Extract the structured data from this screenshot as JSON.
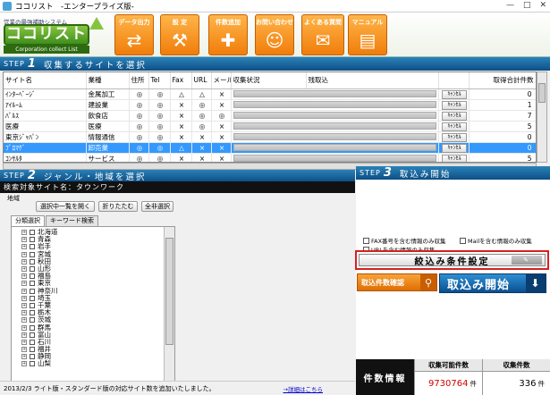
{
  "window": {
    "title": "ココリスト　-エンタープライズ版-",
    "controls": [
      "—",
      "□",
      "✕"
    ]
  },
  "logo": {
    "subtitle": "営業の最強補助システム",
    "main": "ココリスト",
    "english": "Corporation collect List"
  },
  "toolbar": [
    {
      "label": "データ出力",
      "icon": "⇄",
      "icon_name": "export-arrows-icon"
    },
    {
      "label": "設 定",
      "icon": "⚒",
      "icon_name": "wrench-icon"
    },
    {
      "label": "件数追加",
      "icon": "✚",
      "icon_name": "add-document-icon"
    },
    {
      "label": "お問い合わせ",
      "icon": "☺",
      "icon_name": "contact-people-icon"
    },
    {
      "label": "よくある質問",
      "icon": "✉",
      "icon_name": "faq-chat-icon"
    },
    {
      "label": "マニュアル",
      "icon": "▤",
      "icon_name": "manual-book-icon"
    }
  ],
  "step1": {
    "badge": "STEP",
    "num": "1",
    "title": "収集するサイトを選択"
  },
  "site_table": {
    "columns": [
      "サイト名",
      "業種",
      "住所",
      "Tel",
      "Fax",
      "URL",
      "メール",
      "収集状況",
      "残取込",
      "",
      "取得合計件数"
    ],
    "rows": [
      {
        "name": "ｲﾝﾀｰﾍﾞｰｼﾞ",
        "industry": "金属加工",
        "addr": "◎",
        "tel": "◎",
        "fax": "△",
        "url": "△",
        "mail": "×",
        "cancel": "ｷｬﾝｾﾙ",
        "total": "0"
      },
      {
        "name": "ｱｲﾙｰﾑ",
        "industry": "建設業",
        "addr": "◎",
        "tel": "◎",
        "fax": "×",
        "url": "◎",
        "mail": "×",
        "cancel": "ｷｬﾝｾﾙ",
        "total": "1"
      },
      {
        "name": "ﾊﾟﾙｽ",
        "industry": "飲食店",
        "addr": "◎",
        "tel": "◎",
        "fax": "×",
        "url": "◎",
        "mail": "◎",
        "cancel": "ｷｬﾝｾﾙ",
        "total": "7"
      },
      {
        "name": "医療",
        "industry": "医療",
        "addr": "◎",
        "tel": "◎",
        "fax": "×",
        "url": "◎",
        "mail": "×",
        "cancel": "ｷｬﾝｾﾙ",
        "total": "5"
      },
      {
        "name": "東京ｼﾞｬﾊﾟﾝ",
        "industry": "情報通信",
        "addr": "◎",
        "tel": "◎",
        "fax": "×",
        "url": "×",
        "mail": "×",
        "cancel": "ｷｬﾝｾﾙ",
        "total": "0"
      },
      {
        "name": "ﾌﾟﾛﾏｹﾞ",
        "industry": "卸売業",
        "addr": "◎",
        "tel": "◎",
        "fax": "△",
        "url": "×",
        "mail": "×",
        "cancel": "ｷｬﾝｾﾙ",
        "total": "0",
        "selected": true
      },
      {
        "name": "ｺﾝｻﾙﾀ",
        "industry": "サービス",
        "addr": "◎",
        "tel": "◎",
        "fax": "×",
        "url": "×",
        "mail": "×",
        "cancel": "ｷｬﾝｾﾙ",
        "total": "5"
      }
    ]
  },
  "step2": {
    "badge": "STEP",
    "num": "2",
    "title": "ジャンル・地域を選択"
  },
  "category_bar": "検索対象サイト名：タウンワーク",
  "region": {
    "label": "地域",
    "buttons": [
      "選択中一覧を開く",
      "折りたたむ",
      "全非選択"
    ]
  },
  "tabs": [
    "分類選択",
    "キーワード検索"
  ],
  "prefectures": [
    "北海道",
    "青森",
    "岩手",
    "宮城",
    "秋田",
    "山形",
    "福島",
    "東京",
    "神奈川",
    "埼玉",
    "千葉",
    "栃木",
    "茨城",
    "群馬",
    "富山",
    "石川",
    "福井",
    "静岡",
    "山梨"
  ],
  "step3": {
    "badge": "STEP",
    "num": "3",
    "title": "取込み開始"
  },
  "options": {
    "fax": "FAX番号を含む情報のみ収集",
    "mail": "Mailを含む情報のみ収集",
    "url": "URLを含む情報のみ収集"
  },
  "condition_button": "絞込み条件設定",
  "count_button": "取込件数確認",
  "start_button": "取込み開始",
  "status": {
    "text": "2013/2/3 ライト版・スタンダード版の対応サイト数を追加いたしました。",
    "link": "→詳細はこちら"
  },
  "counts": {
    "label": "件数情報",
    "available_header": "収集可能件数",
    "available": "9730764",
    "collected_header": "収集件数",
    "collected": "336",
    "unit": "件"
  },
  "colors": {
    "accent_orange": "#f07d0a",
    "step_blue": "#0d4f86",
    "highlight_red": "#d62020",
    "count_red": "#d00000"
  }
}
